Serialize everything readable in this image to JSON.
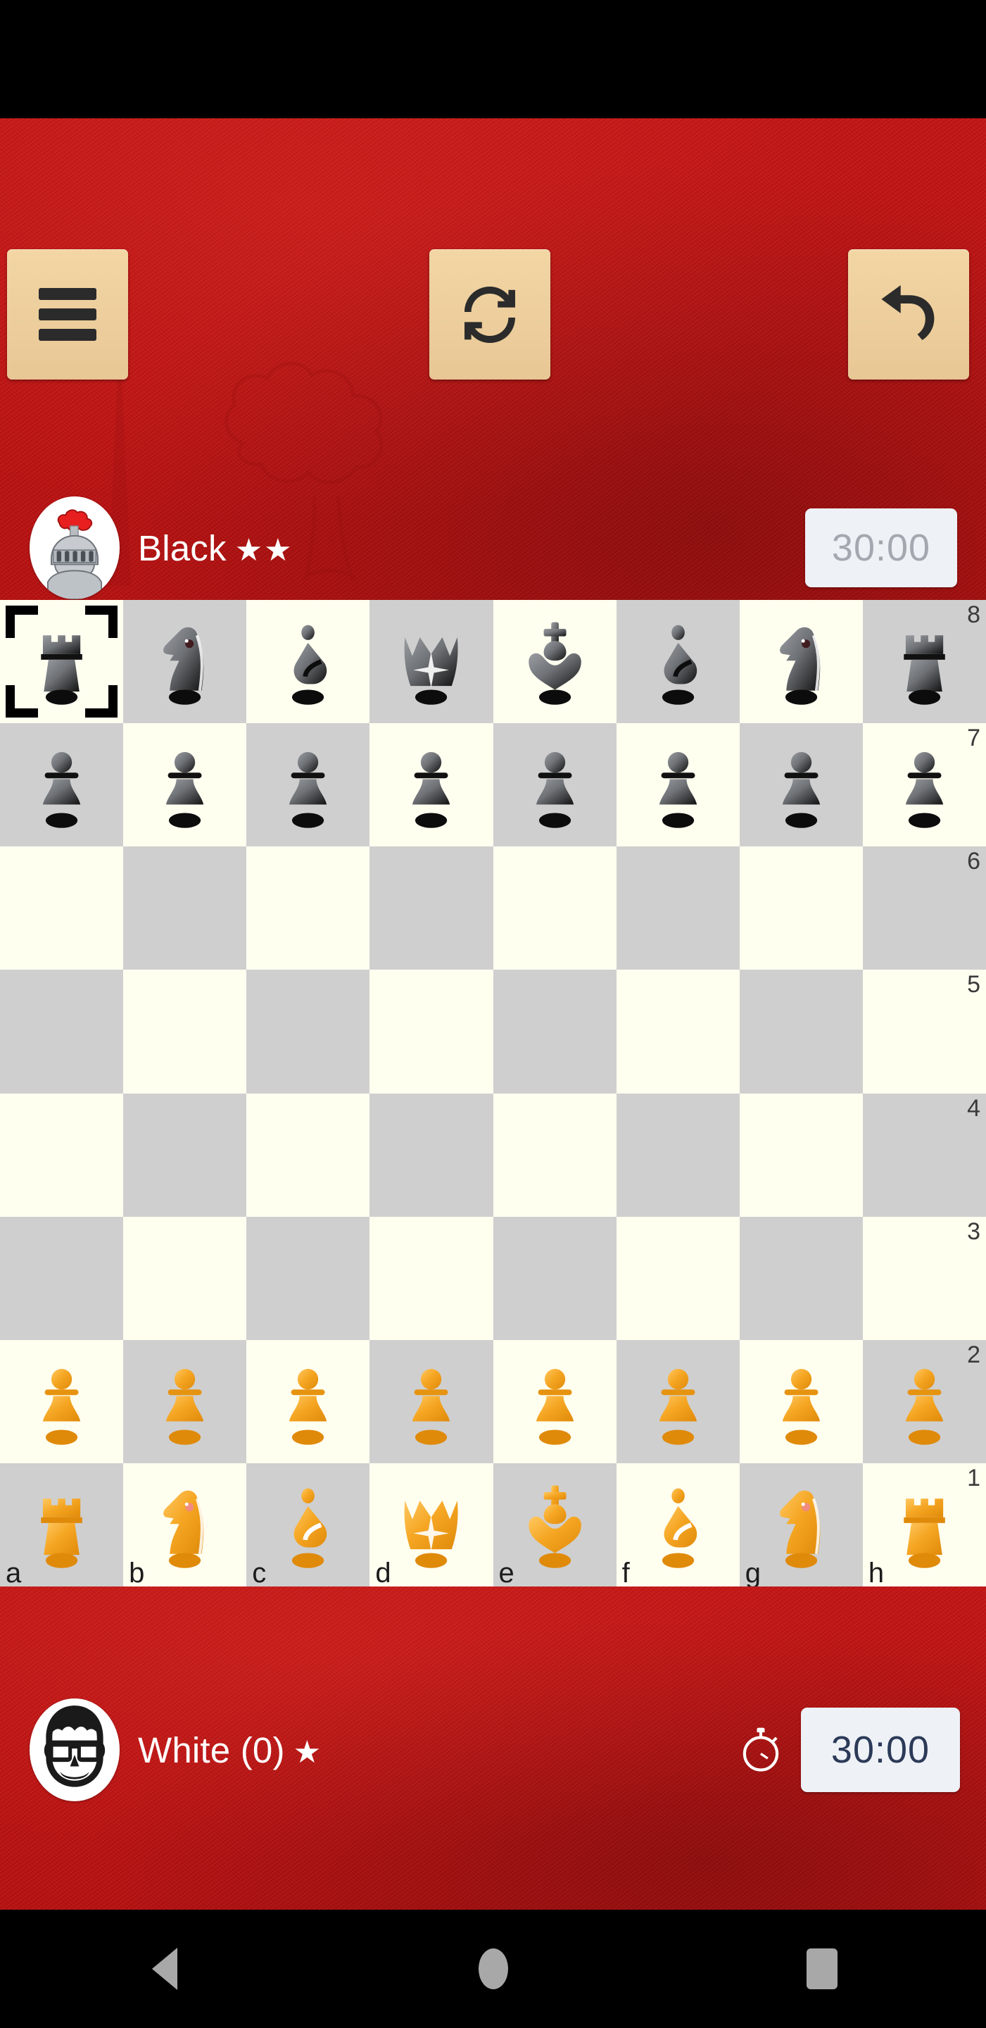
{
  "app": {
    "board_theme": {
      "light_square": "#FFFFF0",
      "dark_square": "#CFCFCF",
      "background_red": "#C41414",
      "button_tan": "#F0D3A0",
      "white_piece": "#F5A623",
      "black_piece": "#2B2B2B"
    }
  },
  "toolbar": {
    "menu_label": "Menu",
    "menu_icon": "hamburger-menu-icon",
    "flip_label": "Flip board",
    "flip_icon": "refresh-rotate-icon",
    "undo_label": "Undo move",
    "undo_icon": "undo-arrow-icon"
  },
  "players": {
    "black": {
      "name": "Black",
      "stars": "★★",
      "star_count": 2,
      "avatar_icon": "knight-helmet-avatar",
      "clock": "30:00",
      "clock_active": false,
      "clock_color": "#A3A8B0",
      "has_stopwatch_icon": false
    },
    "white": {
      "name": "White (0)",
      "stars": "★",
      "star_count": 1,
      "avatar_icon": "smiling-face-sunglasses-avatar",
      "clock": "30:00",
      "clock_active": true,
      "clock_color": "#2B3A57",
      "has_stopwatch_icon": true,
      "stopwatch_icon": "stopwatch-icon"
    }
  },
  "board": {
    "orientation": "white-bottom",
    "selected_square": "a8",
    "selection_style": "corner-brackets",
    "rank_labels": [
      "8",
      "7",
      "6",
      "5",
      "4",
      "3",
      "2",
      "1"
    ],
    "file_labels": [
      "a",
      "b",
      "c",
      "d",
      "e",
      "f",
      "g",
      "h"
    ],
    "position_fen": "rnbqkbnr/pppppppp/8/8/8/8/PPPPPPPP/RNBQKBNR",
    "ranks": [
      [
        "br",
        "bn",
        "bb",
        "bq",
        "bk",
        "bb",
        "bn",
        "br"
      ],
      [
        "bp",
        "bp",
        "bp",
        "bp",
        "bp",
        "bp",
        "bp",
        "bp"
      ],
      [
        "",
        "",
        "",
        "",
        "",
        "",
        "",
        ""
      ],
      [
        "",
        "",
        "",
        "",
        "",
        "",
        "",
        ""
      ],
      [
        "",
        "",
        "",
        "",
        "",
        "",
        "",
        ""
      ],
      [
        "",
        "",
        "",
        "",
        "",
        "",
        "",
        ""
      ],
      [
        "wp",
        "wp",
        "wp",
        "wp",
        "wp",
        "wp",
        "wp",
        "wp"
      ],
      [
        "wr",
        "wn",
        "wb",
        "wq",
        "wk",
        "wb",
        "wn",
        "wr"
      ]
    ]
  },
  "navbar": {
    "back_icon": "android-back-triangle-icon",
    "home_icon": "android-home-circle-icon",
    "recents_icon": "android-recents-square-icon"
  }
}
